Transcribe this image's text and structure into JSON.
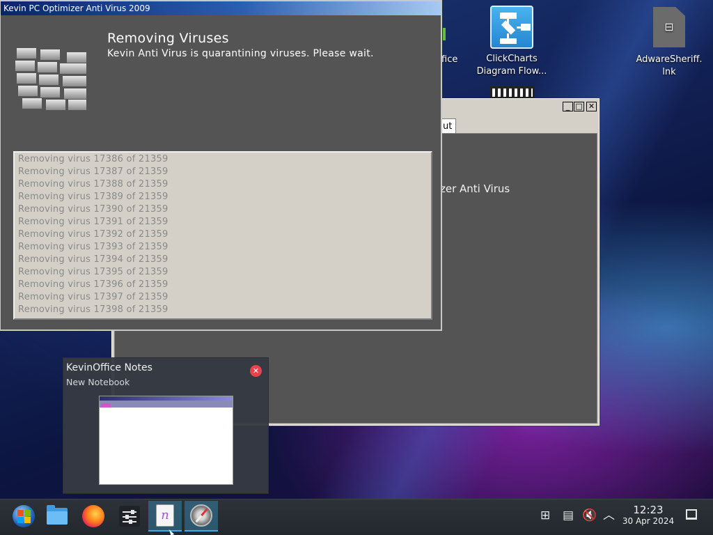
{
  "desktop": {
    "icons": [
      {
        "label_line1": "ClickCharts",
        "label_line2": "Diagram Flow..."
      },
      {
        "label_line1": "AdwareSheriff.",
        "label_line2": "lnk"
      }
    ],
    "partial_label_fice": "fice"
  },
  "background_window": {
    "tab_stub": "ut",
    "body_snippet": "zer Anti Virus"
  },
  "antivirus_window": {
    "title": "Kevin PC Optimizer Anti Virus 2009",
    "heading": "Removing Viruses",
    "subheading": "Kevin Anti Virus is quarantining viruses. Please wait.",
    "log_lines": [
      "Removing virus 17386 of 21359",
      "Removing virus 17387 of 21359",
      "Removing virus 17388 of 21359",
      "Removing virus 17389 of 21359",
      "Removing virus 17390 of 21359",
      "Removing virus 17391 of 21359",
      "Removing virus 17392 of 21359",
      "Removing virus 17393 of 21359",
      "Removing virus 17394 of 21359",
      "Removing virus 17395 of 21359",
      "Removing virus 17396 of 21359",
      "Removing virus 17397 of 21359",
      "Removing virus 17398 of 21359"
    ]
  },
  "task_preview": {
    "app_name": "KevinOffice Notes",
    "window_title": "New Notebook",
    "close_glyph": "✕"
  },
  "taskbar": {
    "clock_time": "12:23",
    "clock_date": "30 Apr 2024",
    "accent": "#3daee9",
    "items": [
      "start-menu",
      "file-manager",
      "firefox",
      "system-settings",
      "kevinoffice-notes",
      "browser-compass"
    ]
  }
}
